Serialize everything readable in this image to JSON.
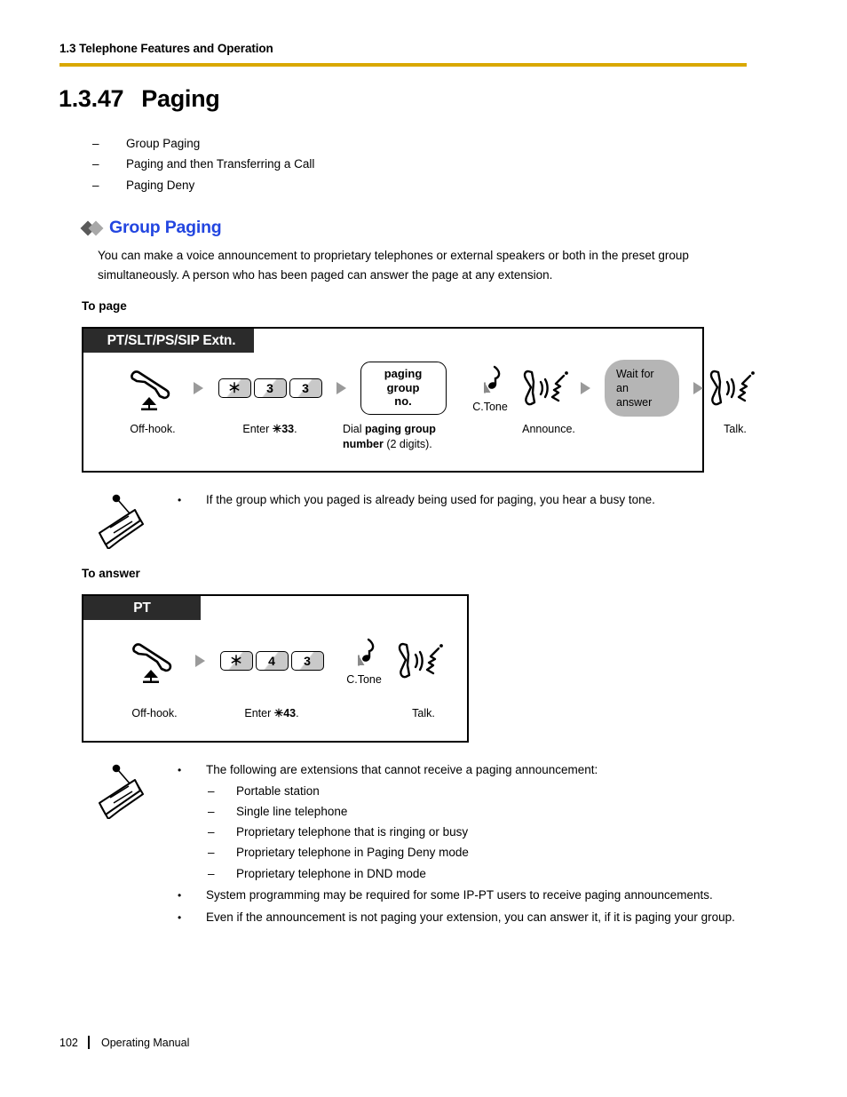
{
  "header": {
    "running_head": "1.3 Telephone Features and Operation",
    "rule_color": "#D9A800"
  },
  "section": {
    "number": "1.3.47",
    "title": "Paging"
  },
  "topics": [
    "Group Paging",
    "Paging and then Transferring a Call",
    "Paging Deny"
  ],
  "dash": "–",
  "bullet": "•",
  "subsection": {
    "heading": "Group Paging",
    "heading_color": "#2346E0",
    "intro": "You can make a voice announcement to proprietary telephones or external speakers or both in the preset group simultaneously. A person who has been paged can answer the page at any extension."
  },
  "to_page": {
    "label": "To page",
    "tab": "PT/SLT/PS/SIP Extn.",
    "steps": {
      "offhook_caption": "Off-hook.",
      "keys": [
        "＊",
        "3",
        "3"
      ],
      "keys_caption_prefix": "Enter ",
      "keys_caption_code": "✳33",
      "keys_caption_suffix": ".",
      "capsule_line1": "paging group",
      "capsule_line2": "no.",
      "capsule_caption_prefix": "Dial ",
      "capsule_caption_bold1": "paging group",
      "capsule_caption_bold2": "number",
      "capsule_caption_suffix": " (2 digits).",
      "ctone_label": "C.Tone",
      "announce_caption": "Announce.",
      "wait_pill_line1": "Wait for an",
      "wait_pill_line2": "answer",
      "talk_caption": "Talk."
    },
    "note": "If the group which you paged is already being used for paging, you hear a busy tone."
  },
  "to_answer": {
    "label": "To answer",
    "tab": "PT",
    "steps": {
      "offhook_caption": "Off-hook.",
      "keys": [
        "＊",
        "4",
        "3"
      ],
      "keys_caption_prefix": "Enter ",
      "keys_caption_code": "✳43",
      "keys_caption_suffix": ".",
      "ctone_label": "C.Tone",
      "talk_caption": "Talk."
    }
  },
  "notes_bottom": {
    "bullet_1": "The following are extensions that cannot receive a paging announcement:",
    "sub_items": [
      "Portable station",
      "Single line telephone",
      "Proprietary telephone that is ringing or busy",
      "Proprietary telephone in Paging Deny mode",
      "Proprietary telephone in DND mode"
    ],
    "bullet_2": "System programming may be required for some IP-PT users to receive paging announcements.",
    "bullet_3": "Even if the announcement is not paging your extension, you can answer it, if it is paging your group."
  },
  "footer": {
    "page_number": "102",
    "manual_name": "Operating Manual"
  }
}
